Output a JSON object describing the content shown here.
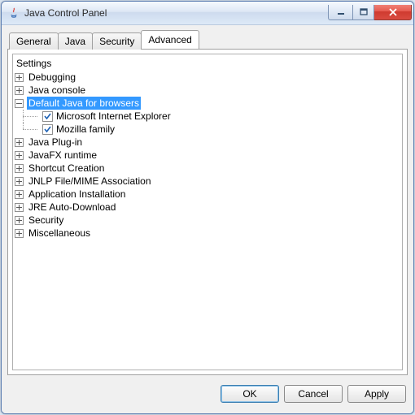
{
  "window": {
    "title": "Java Control Panel"
  },
  "tabs": {
    "items": [
      {
        "label": "General"
      },
      {
        "label": "Java"
      },
      {
        "label": "Security"
      },
      {
        "label": "Advanced"
      }
    ],
    "active": 3
  },
  "tree": {
    "root": "Settings",
    "nodes": [
      {
        "label": "Debugging",
        "expanded": false
      },
      {
        "label": "Java console",
        "expanded": false
      },
      {
        "label": "Default Java for browsers",
        "expanded": true,
        "selected": true,
        "children": [
          {
            "label": "Microsoft Internet Explorer",
            "checked": true
          },
          {
            "label": "Mozilla family",
            "checked": true
          }
        ]
      },
      {
        "label": "Java Plug-in",
        "expanded": false
      },
      {
        "label": "JavaFX runtime",
        "expanded": false
      },
      {
        "label": "Shortcut Creation",
        "expanded": false
      },
      {
        "label": "JNLP File/MIME Association",
        "expanded": false
      },
      {
        "label": "Application Installation",
        "expanded": false
      },
      {
        "label": "JRE Auto-Download",
        "expanded": false
      },
      {
        "label": "Security",
        "expanded": false
      },
      {
        "label": "Miscellaneous",
        "expanded": false
      }
    ]
  },
  "buttons": {
    "ok": "OK",
    "cancel": "Cancel",
    "apply": "Apply"
  }
}
